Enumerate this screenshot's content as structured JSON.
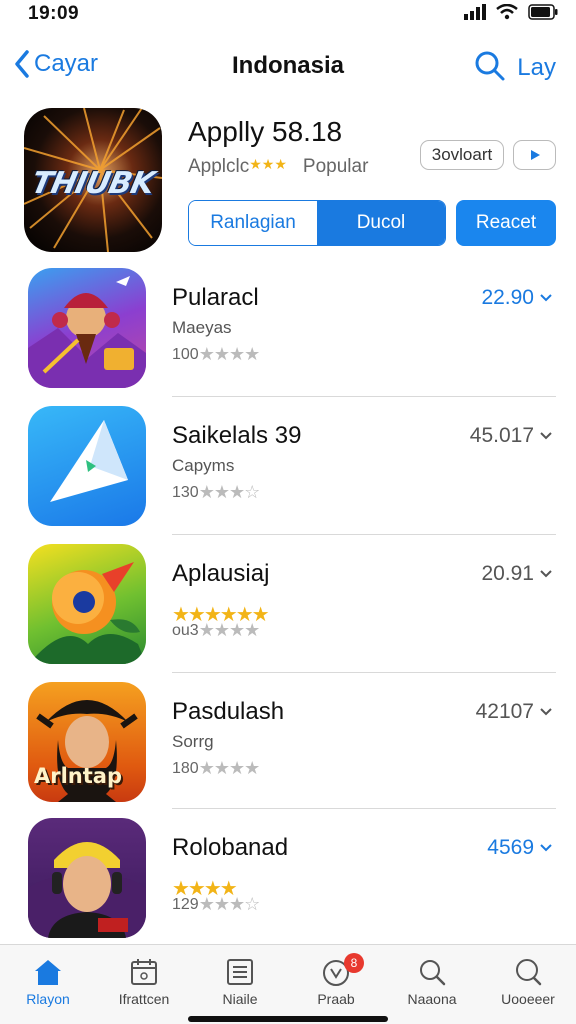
{
  "status": {
    "time": "19:09"
  },
  "nav": {
    "back_label": "Cayar",
    "title": "Indonasia",
    "right_label": "Lay"
  },
  "featured": {
    "icon_text": "THIUBK",
    "title": "Applly 58.18",
    "subtitle_left": "Applclc",
    "subtitle_right": "Popular",
    "chip_1": "3ovloart",
    "chip_2": "▸",
    "segment_a": "Ranlagian",
    "segment_b": "Ducol",
    "action_button": "Reacet"
  },
  "apps": [
    {
      "name": "Pularacl",
      "category": "Maeyas",
      "rating_count": "100",
      "price": "22.90",
      "price_color": "#1a7ae0",
      "icon": "hero-fire-icon"
    },
    {
      "name": "Saikelals 39",
      "category": "Capyms",
      "rating_count": "130",
      "price": "45.017",
      "price_color": "#555555",
      "icon": "paper-plane-icon"
    },
    {
      "name": "Aplausiaj",
      "category": "",
      "rating_count": "ou3",
      "price": "20.91",
      "price_color": "#555555",
      "icon": "orange-bird-icon"
    },
    {
      "name": "Pasdulash",
      "category": "Sorrg",
      "rating_count": "180",
      "price": "42107",
      "price_color": "#555555",
      "icon": "pirate-hero-icon",
      "icon_text": "Arlntap"
    },
    {
      "name": "Rolobanad",
      "category": "",
      "rating_count": "129",
      "price": "4569",
      "price_color": "#1a7ae0",
      "icon": "headset-boy-icon"
    }
  ],
  "tabs": [
    {
      "label": "Rlayon",
      "icon": "home-icon",
      "active": true
    },
    {
      "label": "Ifrattcen",
      "icon": "calendar-icon",
      "active": false
    },
    {
      "label": "Niaile",
      "icon": "list-icon",
      "active": false
    },
    {
      "label": "Praab",
      "icon": "bell-icon",
      "active": false,
      "badge": "8"
    },
    {
      "label": "Naaona",
      "icon": "search-icon",
      "active": false
    },
    {
      "label": "Uooeeer",
      "icon": "search-icon",
      "active": false
    }
  ]
}
